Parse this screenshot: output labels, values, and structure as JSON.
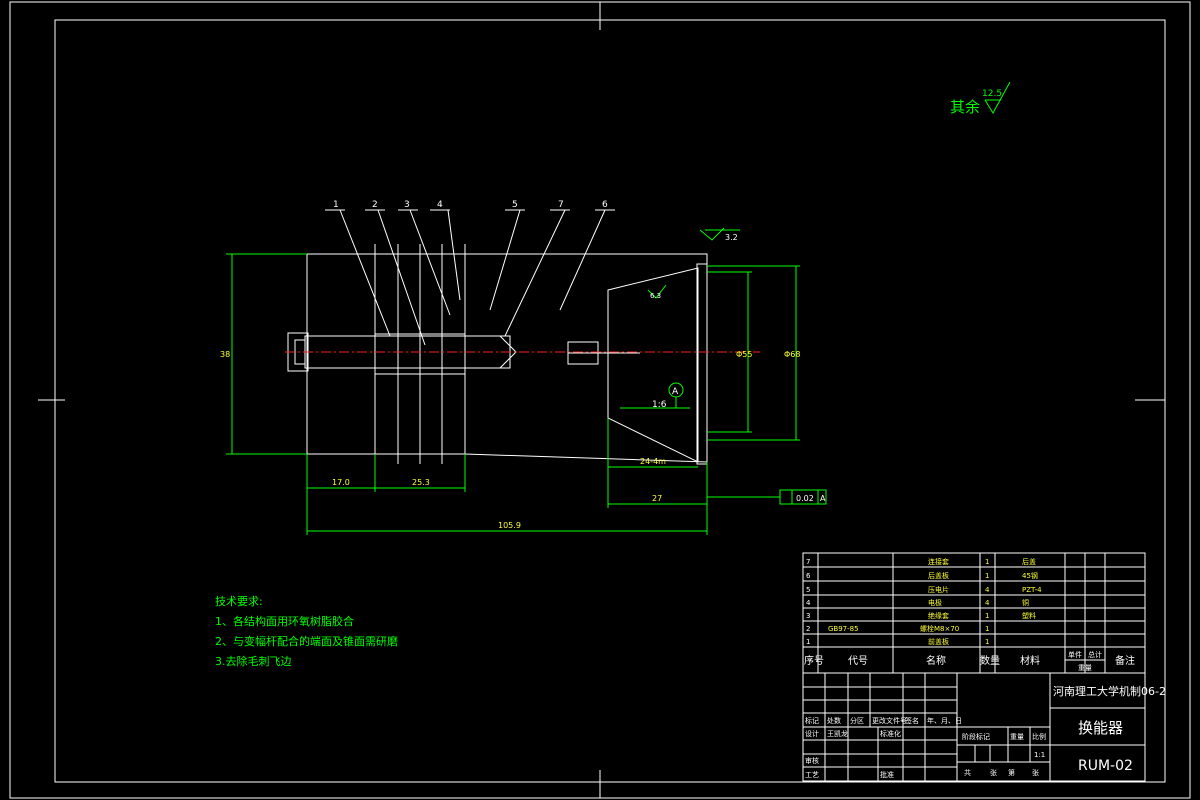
{
  "roughness_note": {
    "label": "其余",
    "value": "12.5"
  },
  "part_labels": [
    "1",
    "2",
    "3",
    "4",
    "5",
    "7",
    "6"
  ],
  "dimensions": {
    "height_left": "38",
    "d_inner": "Φ55",
    "d_outer": "Φ68",
    "len_17": "17.0",
    "len_25": "25.3",
    "len_24": "24-4m",
    "len_27": "27",
    "len_total": "105.9",
    "taper": "1:6",
    "roughness_inner": "6.3",
    "roughness_top": "3.2",
    "flatness": "0.02",
    "datum": "A"
  },
  "tech_requirements": {
    "title": "技术要求:",
    "items": [
      "1、各结构面用环氧树脂胶合",
      "2、与变幅杆配合的端面及锥面需研磨",
      "3.去除毛刺飞边"
    ]
  },
  "bom": {
    "headers": [
      "序号",
      "代号",
      "名称",
      "数量",
      "材料",
      "单件",
      "总计",
      "重量",
      "备注"
    ],
    "rows": [
      {
        "no": "7",
        "code": "",
        "name": "连接套",
        "qty": "1",
        "mat": "后盖"
      },
      {
        "no": "6",
        "code": "",
        "name": "后盖板",
        "qty": "1",
        "mat": "45钢"
      },
      {
        "no": "5",
        "code": "",
        "name": "压电片",
        "qty": "4",
        "mat": "PZT-4"
      },
      {
        "no": "4",
        "code": "",
        "name": "电极",
        "qty": "4",
        "mat": "铜"
      },
      {
        "no": "3",
        "code": "",
        "name": "绝缘套",
        "qty": "1",
        "mat": "塑料"
      },
      {
        "no": "2",
        "code": "GB97-85",
        "name": "螺栓M8×70",
        "qty": "1",
        "mat": ""
      },
      {
        "no": "1",
        "code": "",
        "name": "前盖板",
        "qty": "1",
        "mat": ""
      }
    ]
  },
  "title_block": {
    "school": "河南理工大学机制06-2",
    "drawing_name": "换能器",
    "drawing_no": "RUM-02",
    "scale": "1:1",
    "cells": {
      "mark": "标记",
      "count": "处数",
      "zone": "分区",
      "doc": "更改文件号",
      "sign": "签名",
      "date": "年、月、日",
      "design": "设计",
      "designer": "王凯龙",
      "standard": "标准化",
      "stage": "阶段标记",
      "weight": "重量",
      "ratio": "比例",
      "review": "审核",
      "process": "工艺",
      "approve": "批准",
      "total_sheets": "共",
      "sheets": "张",
      "sheet": "第",
      "sheet_no": "张"
    }
  }
}
